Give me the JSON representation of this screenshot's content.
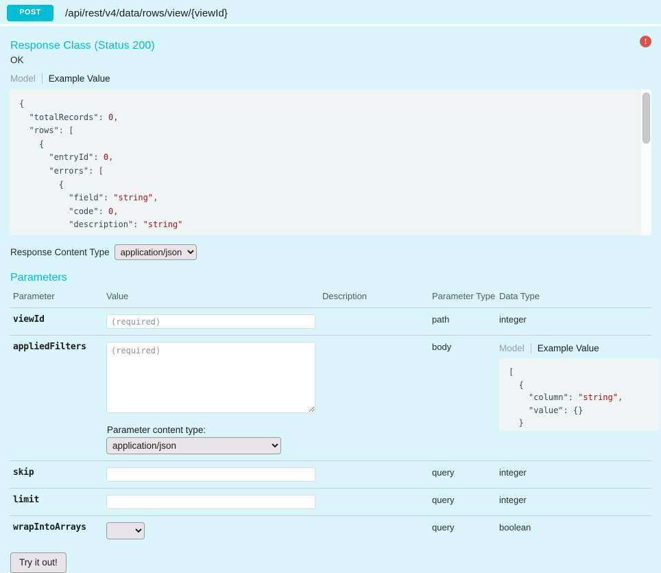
{
  "operation": {
    "method": "POST",
    "path": "/api/rest/v4/data/rows/view/{viewId}",
    "warning_icon": "exclamation-circle-icon",
    "accent_color": "#00bcd4",
    "background_color": "#d9f5f9",
    "warning_color": "#d9534f"
  },
  "response_class": {
    "title": "Response Class (Status 200)",
    "description": "OK",
    "tabs": [
      {
        "label": "Model",
        "active": false
      },
      {
        "label": "Example Value",
        "active": true
      }
    ],
    "example_value": "{\n  \"totalRecords\": 0,\n  \"rows\": [\n    {\n      \"entryId\": 0,\n      \"errors\": [\n        {\n          \"field\": \"string\",\n          \"code\": 0,\n          \"description\": \"string\""
  },
  "response_content_type": {
    "label": "Response Content Type",
    "selected": "application/json",
    "options": [
      "application/json"
    ]
  },
  "parameters": {
    "title": "Parameters",
    "columns": [
      "Parameter",
      "Value",
      "Description",
      "Parameter Type",
      "Data Type"
    ],
    "rows": [
      {
        "name": "viewId",
        "value_placeholder": "(required)",
        "value": "",
        "description": "",
        "param_type": "path",
        "data_type": "integer",
        "control": "input"
      },
      {
        "name": "appliedFilters",
        "value_placeholder": "(required)",
        "value": "",
        "description": "",
        "param_type": "body",
        "data_type": "",
        "control": "textarea",
        "content_type_label": "Parameter content type:",
        "content_type_selected": "application/json",
        "content_type_options": [
          "application/json"
        ],
        "model_tabs": [
          {
            "label": "Model",
            "active": false
          },
          {
            "label": "Example Value",
            "active": true
          }
        ],
        "model_example": "[\n  {\n    \"column\": \"string\",\n    \"value\": {}\n  }\n]"
      },
      {
        "name": "skip",
        "value_placeholder": "",
        "value": "",
        "description": "",
        "param_type": "query",
        "data_type": "integer",
        "control": "input"
      },
      {
        "name": "limit",
        "value_placeholder": "",
        "value": "",
        "description": "",
        "param_type": "query",
        "data_type": "integer",
        "control": "input"
      },
      {
        "name": "wrapIntoArrays",
        "value_placeholder": "",
        "value": "",
        "description": "",
        "param_type": "query",
        "data_type": "boolean",
        "control": "select",
        "select_selected": "",
        "select_options": [
          "",
          "true",
          "false"
        ]
      }
    ]
  },
  "actions": {
    "try_it_out": "Try it out!"
  }
}
